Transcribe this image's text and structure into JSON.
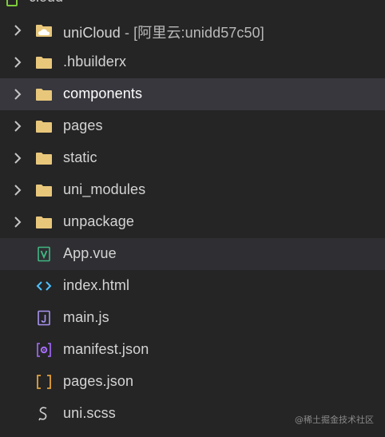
{
  "root": {
    "label": "cloud"
  },
  "items": [
    {
      "name": "uniCloud",
      "suffix": " - [阿里云:unidd57c50]",
      "kind": "cloud-folder",
      "expandable": true
    },
    {
      "name": ".hbuilderx",
      "kind": "folder",
      "expandable": true
    },
    {
      "name": "components",
      "kind": "folder",
      "expandable": true,
      "state": "selected"
    },
    {
      "name": "pages",
      "kind": "folder",
      "expandable": true
    },
    {
      "name": "static",
      "kind": "folder",
      "expandable": true
    },
    {
      "name": "uni_modules",
      "kind": "folder",
      "expandable": true
    },
    {
      "name": "unpackage",
      "kind": "folder",
      "expandable": true
    },
    {
      "name": "App.vue",
      "kind": "vue-file",
      "expandable": false,
      "state": "hover"
    },
    {
      "name": "index.html",
      "kind": "html-file",
      "expandable": false
    },
    {
      "name": "main.js",
      "kind": "js-file",
      "expandable": false
    },
    {
      "name": "manifest.json",
      "kind": "manifest-file",
      "expandable": false
    },
    {
      "name": "pages.json",
      "kind": "json-file",
      "expandable": false
    },
    {
      "name": "uni.scss",
      "kind": "scss-file",
      "expandable": false
    }
  ],
  "colors": {
    "background": "#252526",
    "selected": "#37373d",
    "folder": "#e8c77b",
    "vue": "#41b883",
    "html": "#4fc1ff",
    "js": "#a994f0",
    "manifest": "#a66cff",
    "json": "#e5a23a"
  },
  "watermark": "@稀土掘金技术社区"
}
